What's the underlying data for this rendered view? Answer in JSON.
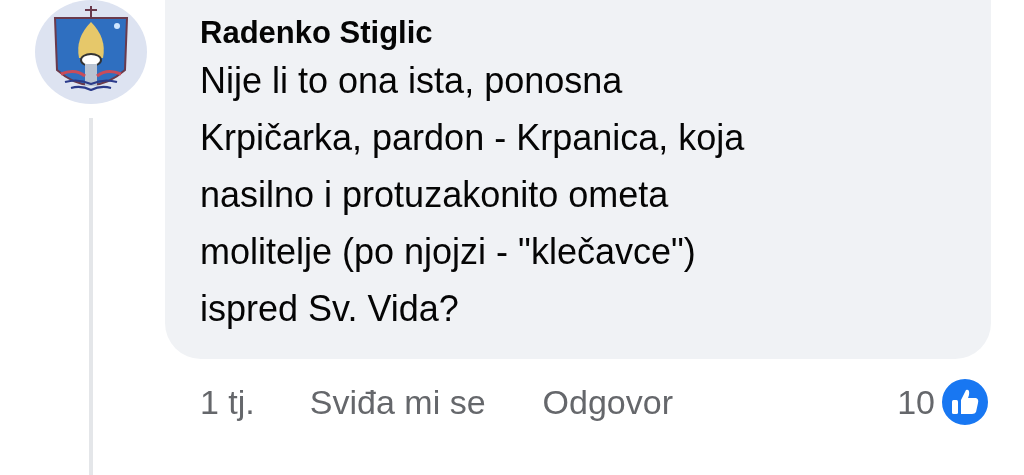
{
  "comment": {
    "author": "Radenko Stiglic",
    "text": "Nije li to ona ista, ponosna\nKrpičarka, pardon - Krpanica, koja\nnasilno i protuzakonito ometa\nmolitelje (po njojzi - \"klečavce\")\nispred Sv. Vida?",
    "time": "1 tj.",
    "actions": [
      {
        "label": "Sviđa mi se"
      },
      {
        "label": "Odgovor"
      }
    ],
    "reaction_count": "10"
  }
}
